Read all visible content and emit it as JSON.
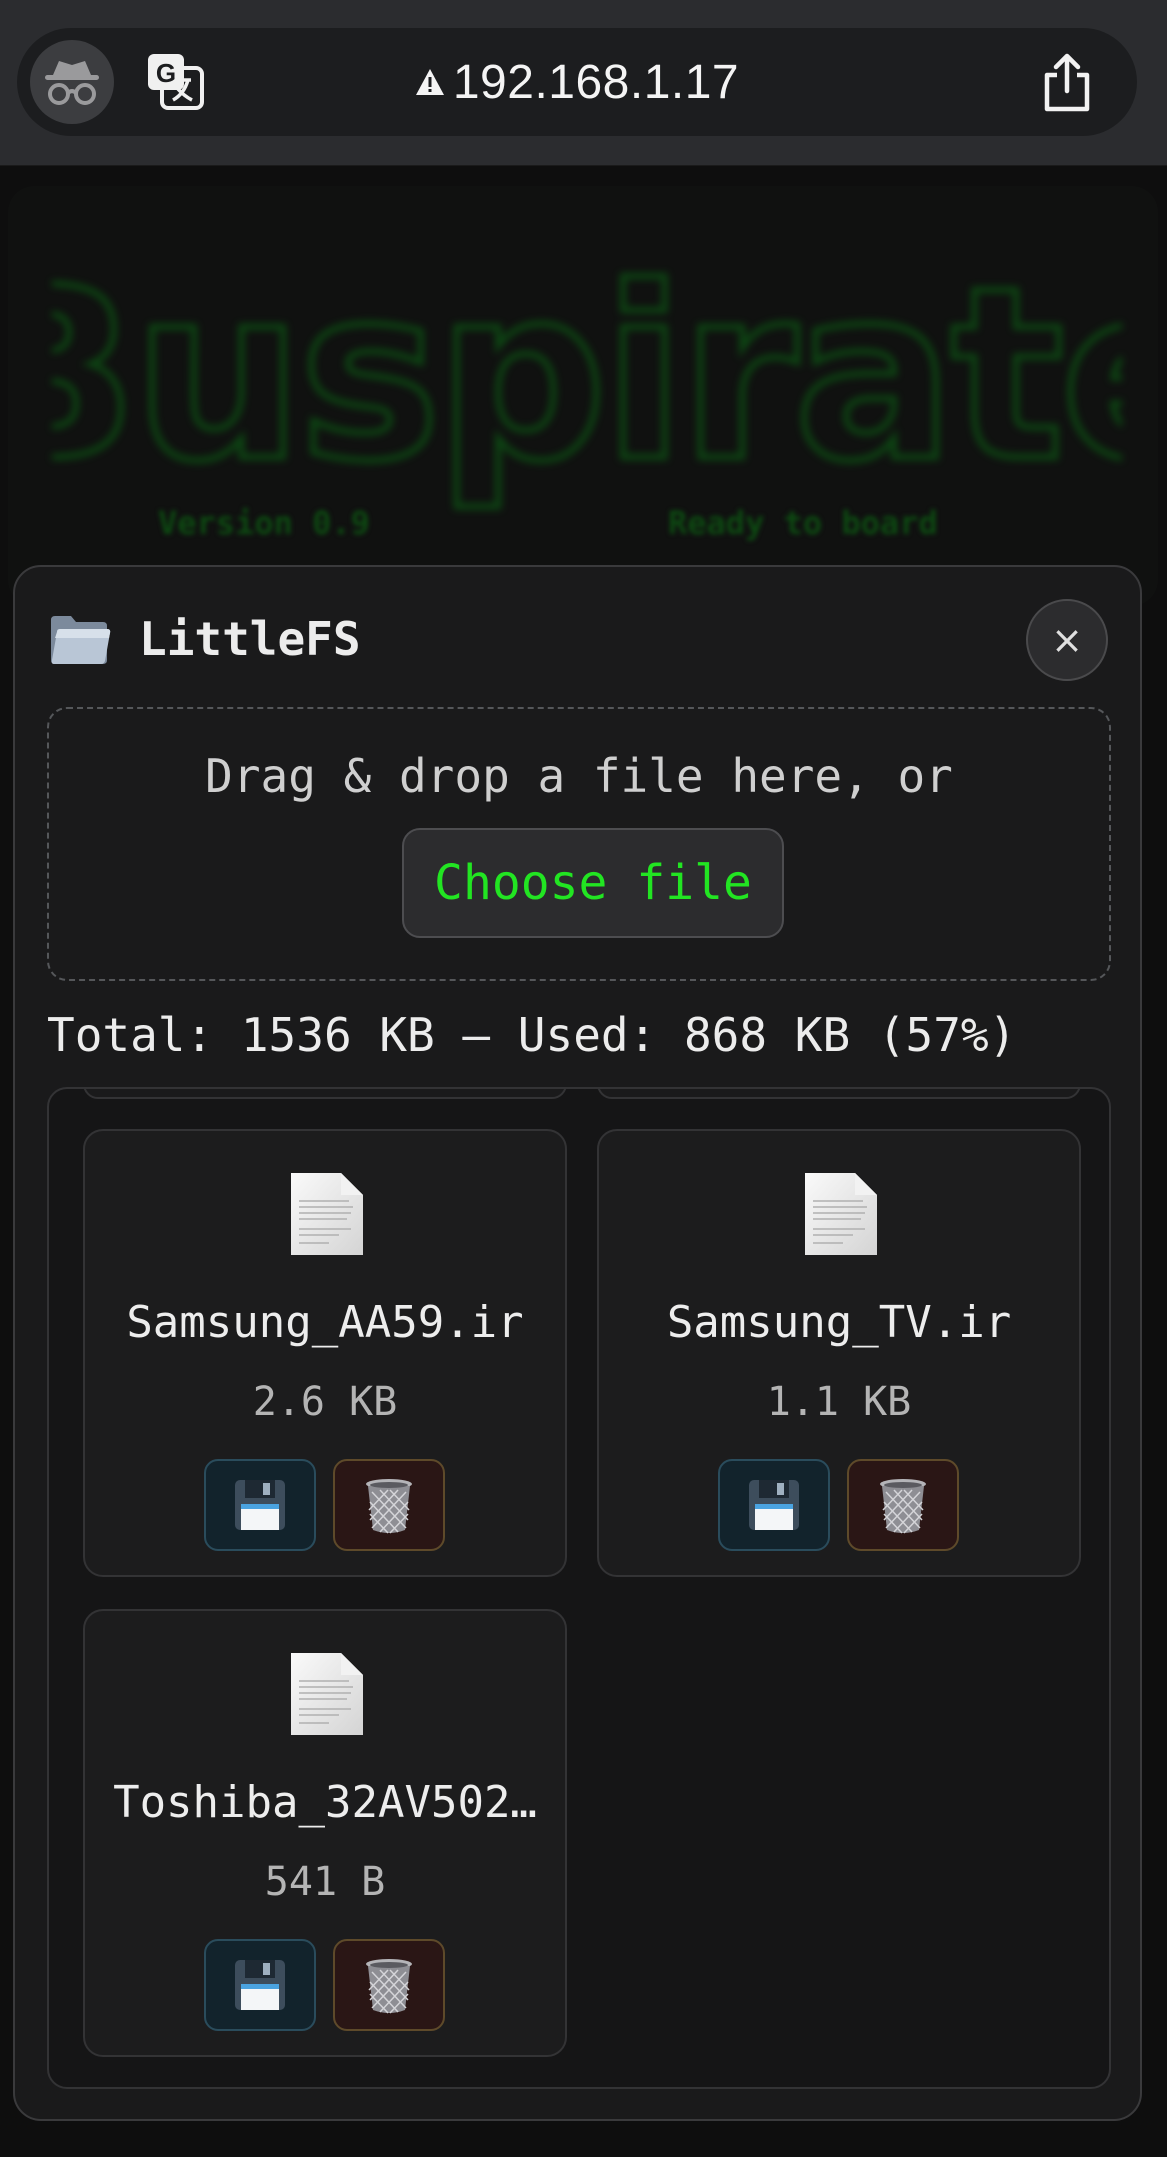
{
  "browser": {
    "url": "192.168.1.17",
    "incognito_icon": "incognito-icon",
    "translate_icon": "translate-icon",
    "warning_icon": "warning-icon",
    "share_icon": "share-icon"
  },
  "banner": {
    "logo_text": "Buspirate",
    "version": "Version 0.9",
    "status": "Ready to board"
  },
  "modal": {
    "icon": "folder-icon",
    "title": "LittleFS",
    "close_label": "×",
    "dropzone_text": "Drag & drop a file here, or",
    "choose_label": "Choose file",
    "usage": "Total: 1536 KB — Used: 868 KB (57%)"
  },
  "files": [
    {
      "name": "Samsung_AA59.ir",
      "size": "2.6 KB"
    },
    {
      "name": "Samsung_TV.ir",
      "size": "1.1 KB"
    },
    {
      "name": "Toshiba_32AV502…",
      "size": "541 B"
    }
  ],
  "colors": {
    "accent_green": "#22e522",
    "banner_green": "#0c5a14"
  }
}
